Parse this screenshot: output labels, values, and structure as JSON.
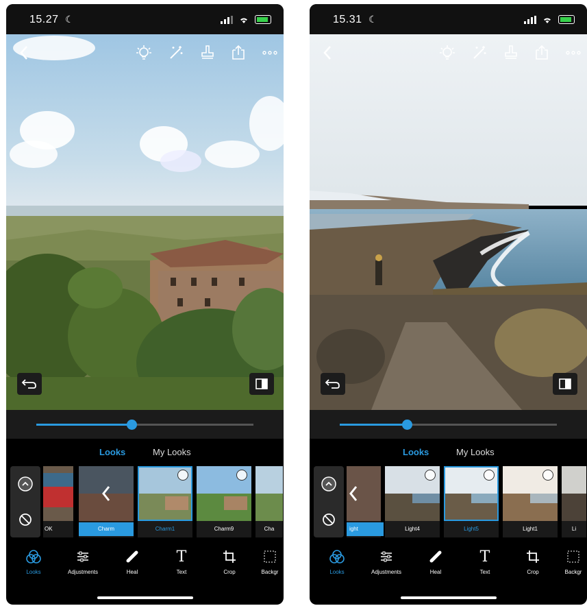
{
  "left": {
    "status_time": "15.27",
    "slider_value": 0.44,
    "tabs": {
      "looks": "Looks",
      "my_looks": "My Looks"
    },
    "thumbs": [
      {
        "label": "OK"
      },
      {
        "label": "Charm"
      },
      {
        "label": "Charm1"
      },
      {
        "label": "Charm9"
      },
      {
        "label": "Cha"
      }
    ]
  },
  "right": {
    "status_time": "15.31",
    "slider_value": 0.31,
    "tabs": {
      "looks": "Looks",
      "my_looks": "My Looks"
    },
    "thumbs": [
      {
        "label": "ight"
      },
      {
        "label": "Light4"
      },
      {
        "label": "Light5"
      },
      {
        "label": "Light1"
      },
      {
        "label": "Li"
      }
    ]
  },
  "nav": {
    "looks": "Looks",
    "adjustments": "Adjustments",
    "heal": "Heal",
    "text": "Text",
    "crop": "Crop",
    "background": "Backgr"
  },
  "icons": {
    "top": [
      "lightbulb-icon",
      "magic-wand-icon",
      "stamp-icon",
      "export-icon",
      "more-icon"
    ],
    "side": [
      "chevron-up-icon",
      "block-icon"
    ]
  },
  "colors": {
    "accent": "#2a9ae0",
    "battery": "#37d14b"
  }
}
